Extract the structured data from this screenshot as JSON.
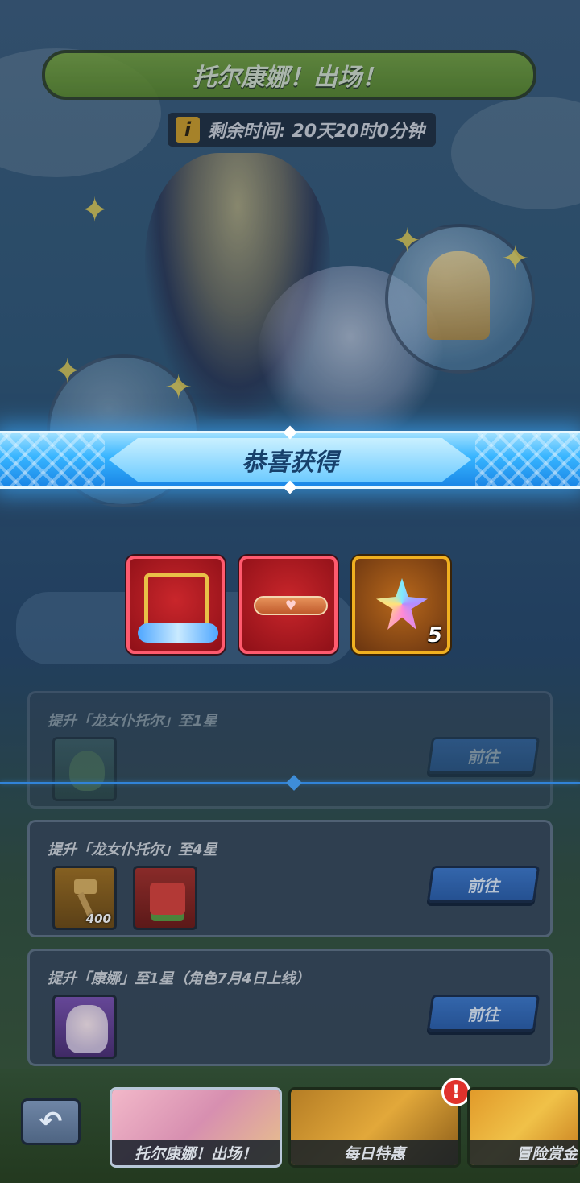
{
  "header": {
    "event_title": "托尔康娜！出场！",
    "timer_text": "剩余时间: 20天20时0分钟",
    "info_icon_glyph": "i"
  },
  "popup": {
    "title": "恭喜获得",
    "rewards": [
      {
        "icon": "avatar-frame-icon",
        "count": ""
      },
      {
        "icon": "nameplate-bar-icon",
        "count": ""
      },
      {
        "icon": "rainbow-crystal-icon",
        "count": "5"
      }
    ]
  },
  "tasks": [
    {
      "title": "提升「龙女仆托尔」至1星",
      "button_label": "前往",
      "items": [
        {
          "icon": "leaf-item-icon",
          "qty": ""
        }
      ]
    },
    {
      "title": "提升「龙女仆托尔」至4星",
      "button_label": "前往",
      "items": [
        {
          "icon": "hammer-item-icon",
          "qty": "400"
        },
        {
          "icon": "gift-pack-icon",
          "qty": ""
        }
      ]
    },
    {
      "title": "提升「康娜」至1星（角色7月4日上线）",
      "button_label": "前往",
      "items": [
        {
          "icon": "kanna-portrait-icon",
          "qty": ""
        }
      ]
    }
  ],
  "bottom_nav": {
    "back_glyph": "↶",
    "tabs": [
      {
        "label": "托尔康娜！出场！",
        "active": true
      },
      {
        "label": "每日特惠",
        "active": false,
        "badge": "!"
      },
      {
        "label": "冒险赏金",
        "active": false
      }
    ]
  },
  "colors": {
    "title_green": "#6a9a2e",
    "banner_blue": "#36b4ff",
    "button_blue": "#3d78c9",
    "alert_red": "#e0322c"
  }
}
